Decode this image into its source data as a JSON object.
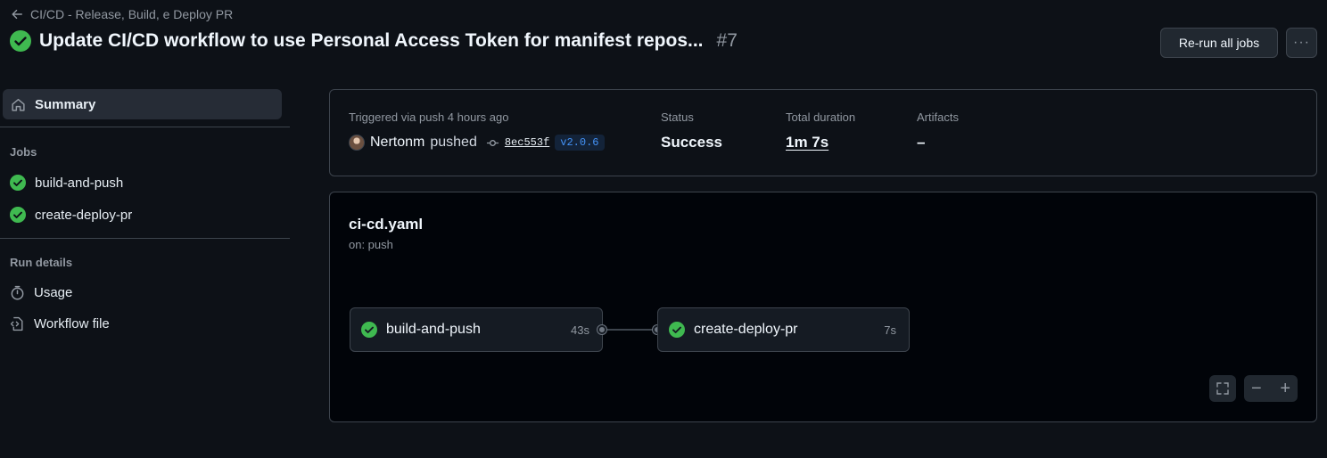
{
  "header": {
    "back_label": "CI/CD - Release, Build, e Deploy PR",
    "title": "Update CI/CD workflow to use Personal Access Token for manifest repos...",
    "run_number": "#7",
    "rerun_label": "Re-run all jobs",
    "more_label": "···"
  },
  "sidebar": {
    "summary_label": "Summary",
    "jobs_heading": "Jobs",
    "jobs": [
      {
        "label": "build-and-push",
        "status": "success"
      },
      {
        "label": "create-deploy-pr",
        "status": "success"
      }
    ],
    "run_details_heading": "Run details",
    "usage_label": "Usage",
    "workflow_file_label": "Workflow file"
  },
  "summary": {
    "trigger_text": "Triggered via push 4 hours ago",
    "actor": "Nertonm",
    "action": "pushed",
    "commit_sha": "8ec553f",
    "tag": "v2.0.6",
    "status_label": "Status",
    "status_value": "Success",
    "duration_label": "Total duration",
    "duration_value": "1m 7s",
    "artifacts_label": "Artifacts",
    "artifacts_value": "–"
  },
  "graph": {
    "workflow_name": "ci-cd.yaml",
    "trigger": "on: push",
    "jobs": [
      {
        "label": "build-and-push",
        "duration": "43s"
      },
      {
        "label": "create-deploy-pr",
        "duration": "7s"
      }
    ],
    "zoom_out": "−",
    "zoom_in": "+"
  },
  "colors": {
    "success": "#3fb950",
    "background": "#0d1117",
    "border": "#3d444d",
    "accent": "#4493f8"
  }
}
